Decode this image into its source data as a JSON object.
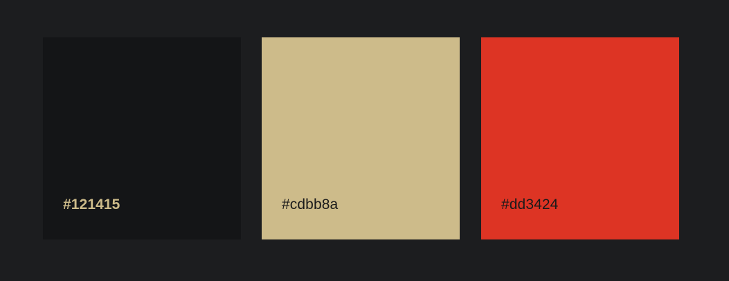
{
  "palette": {
    "swatches": [
      {
        "hex": "#121415",
        "fill": "#141517",
        "label_color": "#cdbb8a"
      },
      {
        "hex": "#cdbb8a",
        "fill": "#cdbb8a",
        "label_color": "#1a1a1a"
      },
      {
        "hex": "#dd3424",
        "fill": "#dd3424",
        "label_color": "#1a1a1a"
      }
    ]
  }
}
